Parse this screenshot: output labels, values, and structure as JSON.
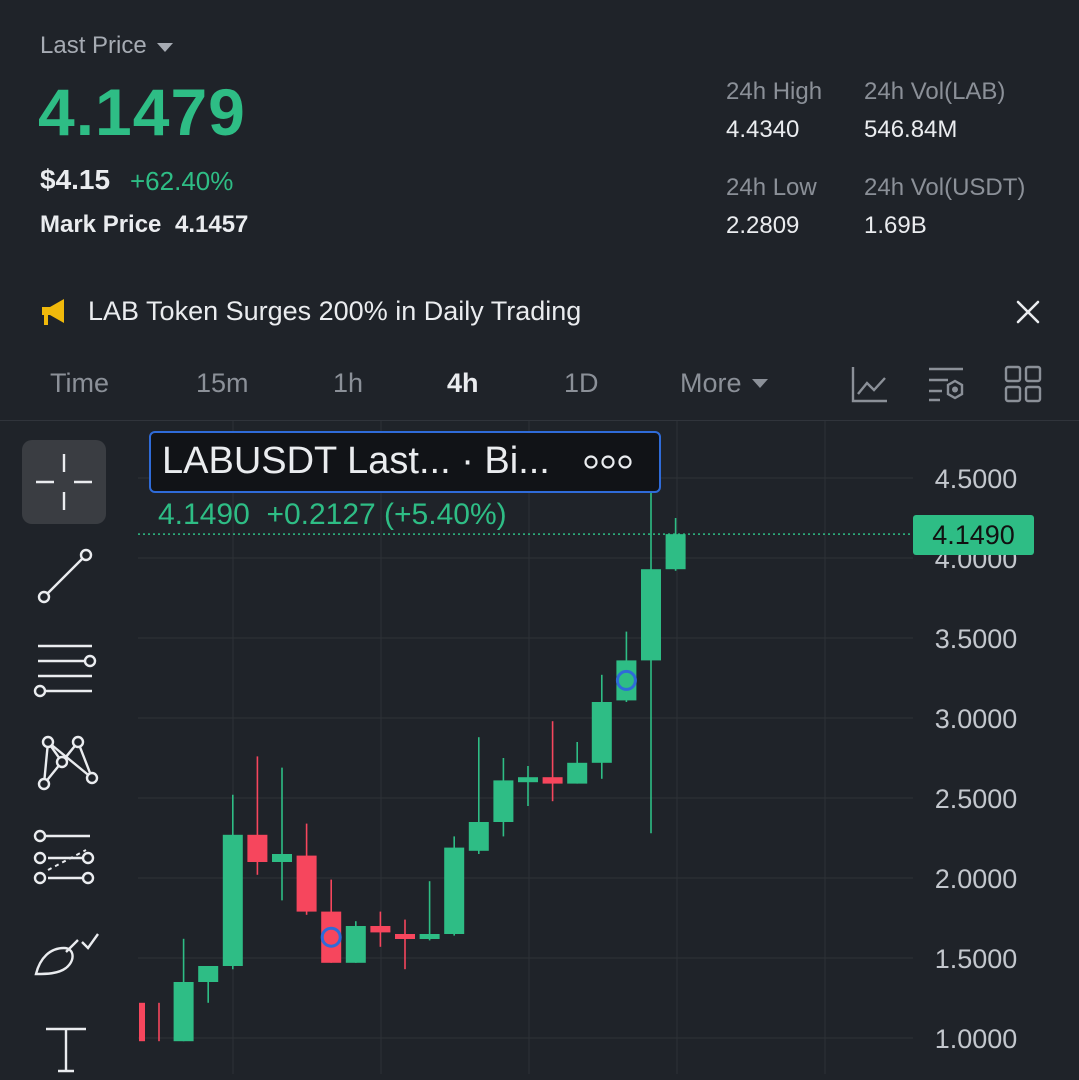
{
  "header": {
    "last_price_label": "Last Price",
    "last_price": "4.1479",
    "usd_price": "$4.15",
    "pct_change": "+62.40%",
    "mark_price_label": "Mark Price",
    "mark_price": "4.1457"
  },
  "stats": {
    "high_label": "24h High",
    "high_value": "4.4340",
    "low_label": "24h Low",
    "low_value": "2.2809",
    "vol_base_label": "24h Vol(LAB)",
    "vol_base_value": "546.84M",
    "vol_quote_label": "24h Vol(USDT)",
    "vol_quote_value": "1.69B"
  },
  "news": {
    "headline": "LAB Token Surges 200% in Daily Trading",
    "icon": "megaphone-icon"
  },
  "tabs": {
    "items": [
      "Time",
      "15m",
      "1h",
      "4h",
      "1D"
    ],
    "active": "4h",
    "more_label": "More"
  },
  "chart_data": {
    "type": "candlestick",
    "symbol_legend": "LABUSDT Last...  · Bi...",
    "legend_price": "4.1490",
    "legend_change": "+0.2127 (+5.40%)",
    "current_price_tag": "4.1490",
    "current_price": 4.149,
    "y_ticks": [
      "4.5000",
      "4.0000",
      "3.5000",
      "3.0000",
      "2.5000",
      "2.0000",
      "1.5000",
      "1.0000"
    ],
    "ylim": [
      1.0,
      4.5
    ],
    "candles": [
      {
        "o": 1.22,
        "h": 1.22,
        "l": 0.98,
        "c": 0.98
      },
      {
        "o": 0.98,
        "h": 1.62,
        "l": 0.98,
        "c": 1.35
      },
      {
        "o": 1.35,
        "h": 1.45,
        "l": 1.22,
        "c": 1.45
      },
      {
        "o": 1.45,
        "h": 2.52,
        "l": 1.43,
        "c": 2.27
      },
      {
        "o": 2.27,
        "h": 2.76,
        "l": 2.02,
        "c": 2.1
      },
      {
        "o": 2.1,
        "h": 2.69,
        "l": 1.86,
        "c": 2.15
      },
      {
        "o": 2.14,
        "h": 2.34,
        "l": 1.77,
        "c": 1.79
      },
      {
        "o": 1.79,
        "h": 1.99,
        "l": 1.47,
        "c": 1.47
      },
      {
        "o": 1.47,
        "h": 1.73,
        "l": 1.47,
        "c": 1.7
      },
      {
        "o": 1.7,
        "h": 1.79,
        "l": 1.57,
        "c": 1.66
      },
      {
        "o": 1.65,
        "h": 1.74,
        "l": 1.43,
        "c": 1.63
      },
      {
        "o": 1.62,
        "h": 1.98,
        "l": 1.61,
        "c": 1.65
      },
      {
        "o": 1.65,
        "h": 2.26,
        "l": 1.64,
        "c": 2.19
      },
      {
        "o": 2.17,
        "h": 2.88,
        "l": 2.15,
        "c": 2.35
      },
      {
        "o": 2.35,
        "h": 2.75,
        "l": 2.26,
        "c": 2.61
      },
      {
        "o": 2.6,
        "h": 2.7,
        "l": 2.45,
        "c": 2.63
      },
      {
        "o": 2.63,
        "h": 2.98,
        "l": 2.48,
        "c": 2.59
      },
      {
        "o": 2.59,
        "h": 2.85,
        "l": 2.59,
        "c": 2.72
      },
      {
        "o": 2.72,
        "h": 3.27,
        "l": 2.62,
        "c": 3.1
      },
      {
        "o": 3.11,
        "h": 3.54,
        "l": 3.1,
        "c": 3.36
      },
      {
        "o": 3.36,
        "h": 4.45,
        "l": 2.28,
        "c": 3.93
      },
      {
        "o": 3.93,
        "h": 4.25,
        "l": 3.92,
        "c": 4.149
      }
    ],
    "markers": [
      7,
      19
    ],
    "grid": true
  },
  "colors": {
    "up": "#2ebd85",
    "down": "#f6465d",
    "background": "#1f2329",
    "grid": "#2c3036",
    "marker": "#2f6bd8"
  }
}
